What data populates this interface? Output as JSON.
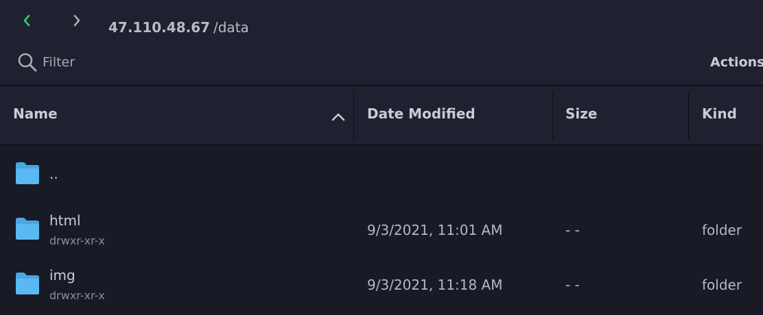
{
  "nav": {
    "back_color": "#2bd46a",
    "forward_color": "#a9adb8"
  },
  "location": {
    "host": "47.110.48.67",
    "path": "/data"
  },
  "filter": {
    "placeholder": "Filter",
    "value": ""
  },
  "actions_label": "Actions",
  "columns": {
    "name": "Name",
    "date": "Date Modified",
    "size": "Size",
    "kind": "Kind",
    "sort": "ascending"
  },
  "rows": [
    {
      "name": "..",
      "permissions": "",
      "date": "",
      "size": "",
      "kind": ""
    },
    {
      "name": "html",
      "permissions": "drwxr-xr-x",
      "date": "9/3/2021, 11:01 AM",
      "size": "- -",
      "kind": "folder"
    },
    {
      "name": "img",
      "permissions": "drwxr-xr-x",
      "date": "9/3/2021, 11:18 AM",
      "size": "- -",
      "kind": "folder"
    }
  ],
  "icons": {
    "back": "chevron-left-icon",
    "forward": "chevron-right-icon",
    "search": "search-icon",
    "sort": "chevron-up-icon",
    "folder": "folder-icon"
  },
  "colors": {
    "folder": "#5ab8f2",
    "background": "#181a26",
    "toolbar": "#1f2130"
  }
}
